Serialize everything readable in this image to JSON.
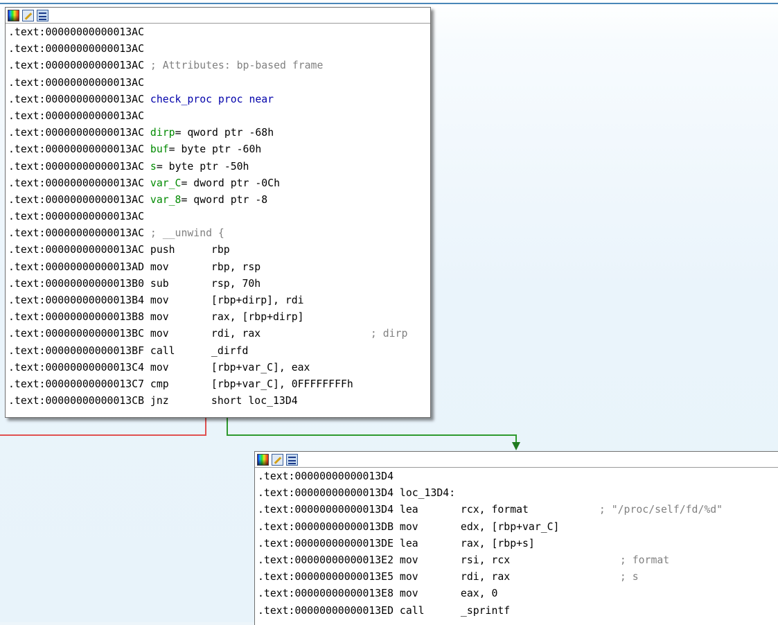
{
  "node1": {
    "toolbar_icons": [
      "color-palette-icon",
      "edit-node-icon",
      "graph-layout-icon"
    ],
    "lines": [
      {
        "addr": ".text:00000000000013AC",
        "text": ""
      },
      {
        "addr": ".text:00000000000013AC",
        "text": ""
      },
      {
        "addr": ".text:00000000000013AC",
        "comment": "; Attributes: bp-based frame"
      },
      {
        "addr": ".text:00000000000013AC",
        "text": ""
      },
      {
        "addr": ".text:00000000000013AC",
        "label": "check_proc proc near"
      },
      {
        "addr": ".text:00000000000013AC",
        "text": ""
      },
      {
        "addr": ".text:00000000000013AC",
        "var": "dirp",
        "def": "= qword ptr -68h"
      },
      {
        "addr": ".text:00000000000013AC",
        "var": "buf",
        "def": "= byte ptr -60h"
      },
      {
        "addr": ".text:00000000000013AC",
        "var": "s",
        "def": "= byte ptr -50h"
      },
      {
        "addr": ".text:00000000000013AC",
        "var": "var_C",
        "def": "= dword ptr -0Ch"
      },
      {
        "addr": ".text:00000000000013AC",
        "var": "var_8",
        "def": "= qword ptr -8"
      },
      {
        "addr": ".text:00000000000013AC",
        "text": ""
      },
      {
        "addr": ".text:00000000000013AC",
        "comment": "; __unwind {"
      },
      {
        "addr": ".text:00000000000013AC",
        "mn": "push",
        "ops": "rbp"
      },
      {
        "addr": ".text:00000000000013AD",
        "mn": "mov",
        "ops": "rbp, rsp"
      },
      {
        "addr": ".text:00000000000013B0",
        "mn": "sub",
        "ops": "rsp, 70h"
      },
      {
        "addr": ".text:00000000000013B4",
        "mn": "mov",
        "ops": "[rbp+dirp], rdi"
      },
      {
        "addr": ".text:00000000000013B8",
        "mn": "mov",
        "ops": "rax, [rbp+dirp]"
      },
      {
        "addr": ".text:00000000000013BC",
        "mn": "mov",
        "ops": "rdi, rax",
        "cmt": "; dirp"
      },
      {
        "addr": ".text:00000000000013BF",
        "mn": "call",
        "ops": "_dirfd"
      },
      {
        "addr": ".text:00000000000013C4",
        "mn": "mov",
        "ops": "[rbp+var_C], eax"
      },
      {
        "addr": ".text:00000000000013C7",
        "mn": "cmp",
        "ops": "[rbp+var_C], 0FFFFFFFFh"
      },
      {
        "addr": ".text:00000000000013CB",
        "mn": "jnz",
        "ops": "short loc_13D4"
      }
    ]
  },
  "node2": {
    "toolbar_icons": [
      "color-palette-icon",
      "edit-node-icon",
      "graph-layout-icon"
    ],
    "lines": [
      {
        "addr": ".text:00000000000013D4",
        "text": ""
      },
      {
        "addr": ".text:00000000000013D4",
        "text": "loc_13D4:"
      },
      {
        "addr": ".text:00000000000013D4",
        "mn": "lea",
        "ops": "rcx, format",
        "cmt": "; \"/proc/self/fd/%d\""
      },
      {
        "addr": ".text:00000000000013DB",
        "mn": "mov",
        "ops": "edx, [rbp+var_C]"
      },
      {
        "addr": ".text:00000000000013DE",
        "mn": "lea",
        "ops": "rax, [rbp+s]"
      },
      {
        "addr": ".text:00000000000013E2",
        "mn": "mov",
        "ops": "rsi, rcx",
        "cmt": "; format"
      },
      {
        "addr": ".text:00000000000013E5",
        "mn": "mov",
        "ops": "rdi, rax",
        "cmt": "; s"
      },
      {
        "addr": ".text:00000000000013E8",
        "mn": "mov",
        "ops": "eax, 0"
      },
      {
        "addr": ".text:00000000000013ED",
        "mn": "call",
        "ops": "_sprintf"
      }
    ]
  },
  "colors": {
    "false_branch": "#e05050",
    "true_branch": "#2e9a2e",
    "label_blue": "#0000aa",
    "var_green": "#008a00",
    "comment_gray": "#808080"
  }
}
